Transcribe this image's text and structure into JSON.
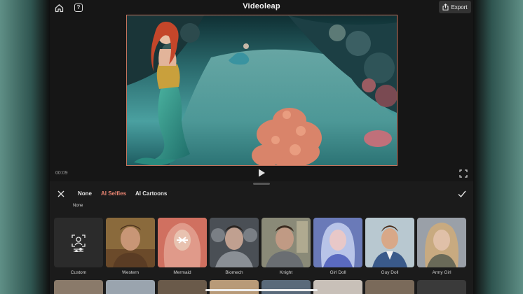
{
  "app": {
    "brand": "Videoleap",
    "export_label": "Export"
  },
  "player": {
    "timecode": "00:09"
  },
  "panel": {
    "tabs": [
      {
        "label": "None",
        "active": false
      },
      {
        "label": "AI Selfies",
        "active": true
      },
      {
        "label": "AI Cartoons",
        "active": false
      }
    ],
    "selected_label": "None",
    "effects": [
      {
        "label": "Custom",
        "icon": "portrait-sliders-icon"
      },
      {
        "label": "Western"
      },
      {
        "label": "Mermaid",
        "selected": true
      },
      {
        "label": "Biomech"
      },
      {
        "label": "Knight"
      },
      {
        "label": "Girl Doll"
      },
      {
        "label": "Guy Doll"
      },
      {
        "label": "Army Girl"
      }
    ]
  },
  "colors": {
    "accent": "#e98572",
    "preview_border": "#c4745e",
    "panel_bg": "#1b1b1b"
  }
}
